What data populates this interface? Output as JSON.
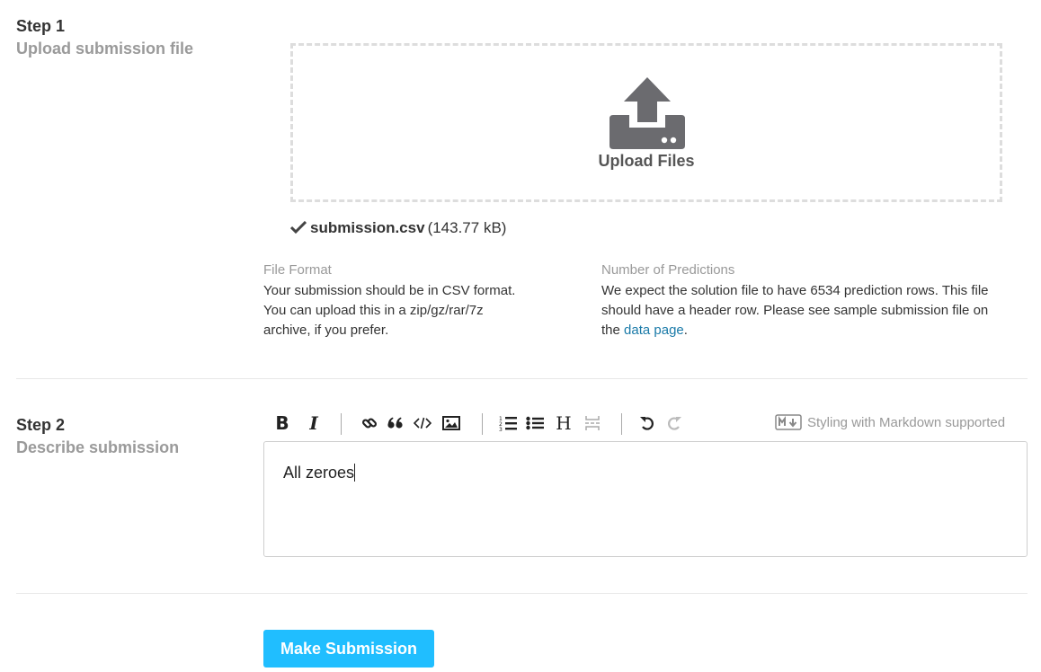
{
  "step1": {
    "title": "Step 1",
    "subtitle": "Upload submission file",
    "dropzone_label": "Upload Files",
    "file": {
      "name": "submission.csv",
      "size": "(143.77 kB)"
    },
    "file_format": {
      "heading": "File Format",
      "line1": "Your submission should be in CSV format.",
      "line2": "You can upload this in a zip/gz/rar/7z",
      "line3": "archive, if you prefer."
    },
    "predictions": {
      "heading": "Number of Predictions",
      "line1": "We expect the solution file to have 6534 prediction rows. This file",
      "line2": "should have a header row. Please see sample submission file on",
      "line3_prefix": "the ",
      "link": "data page",
      "line3_suffix": "."
    }
  },
  "step2": {
    "title": "Step 2",
    "subtitle": "Describe submission",
    "markdown_note": "Styling with Markdown supported",
    "editor_value": "All zeroes",
    "toolbar": [
      "bold-icon",
      "italic-icon",
      "link-icon",
      "quote-icon",
      "code-icon",
      "image-icon",
      "ordered-list-icon",
      "unordered-list-icon",
      "heading-icon",
      "horizontal-rule-icon",
      "undo-icon",
      "redo-icon"
    ]
  },
  "submit_label": "Make Submission",
  "colors": {
    "accent": "#20beff",
    "link": "#1a7aa8",
    "muted": "#999999"
  }
}
